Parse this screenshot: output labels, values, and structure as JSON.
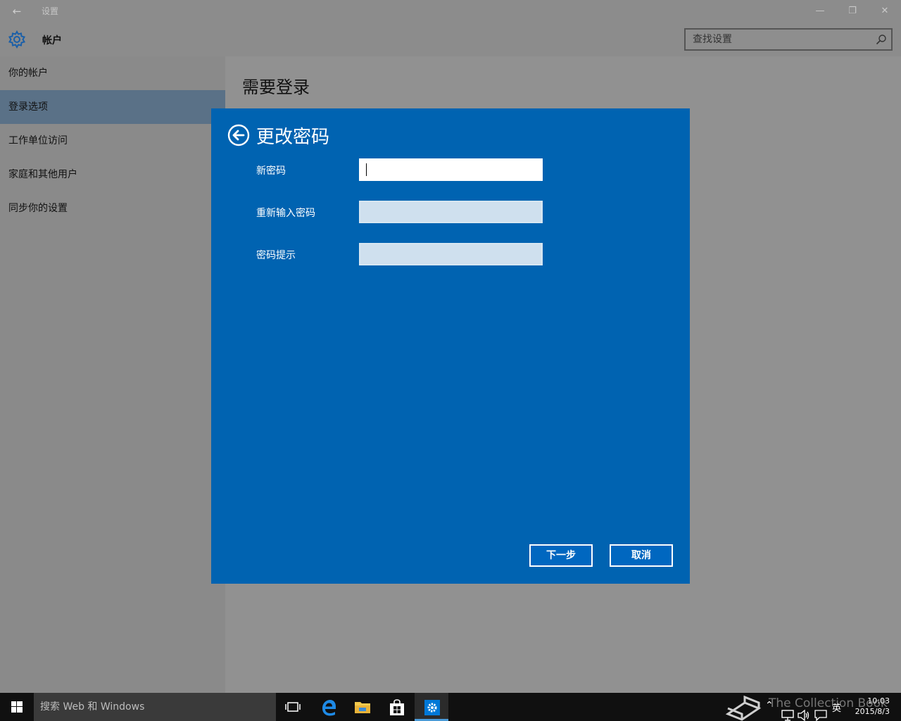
{
  "window": {
    "app_title": "设置",
    "back_glyph": "←",
    "controls": {
      "minimize": "—",
      "restore": "❐",
      "close": "✕"
    }
  },
  "header": {
    "section_title": "帐户",
    "search": {
      "placeholder": "查找设置",
      "value": ""
    }
  },
  "sidebar": {
    "items": [
      {
        "label": "你的帐户",
        "selected": false
      },
      {
        "label": "登录选项",
        "selected": true
      },
      {
        "label": "工作单位访问",
        "selected": false
      },
      {
        "label": "家庭和其他用户",
        "selected": false
      },
      {
        "label": "同步你的设置",
        "selected": false
      }
    ]
  },
  "main": {
    "page_title": "需要登录"
  },
  "dialog": {
    "title": "更改密码",
    "fields": [
      {
        "label": "新密码",
        "value": ""
      },
      {
        "label": "重新输入密码",
        "value": ""
      },
      {
        "label": "密码提示",
        "value": ""
      }
    ],
    "next_label": "下一步",
    "cancel_label": "取消"
  },
  "taskbar": {
    "search_text": "搜索 Web 和 Windows",
    "ime_label": "英",
    "tray_up_glyph": "⌃",
    "time": "10:03",
    "date": "2015/8/3"
  },
  "watermark": "The Collection Book",
  "colors": {
    "dialog_bg": "#0063b1",
    "accent": "#0078d7",
    "selected_nav": "#5a7187"
  }
}
